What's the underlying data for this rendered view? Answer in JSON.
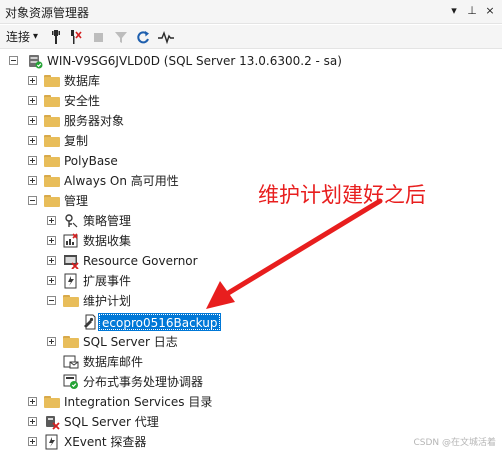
{
  "panel": {
    "title": "对象资源管理器",
    "pin_glyph": "▾",
    "autohide_glyph": "⊥",
    "close_glyph": "×"
  },
  "toolbar": {
    "connect_label": "连接",
    "connect_dropdown_glyph": "▾"
  },
  "tree": {
    "server": "WIN-V9SG6JVLD0D (SQL Server 13.0.6300.2 - sa)",
    "top_nodes": [
      "数据库",
      "安全性",
      "服务器对象",
      "复制",
      "PolyBase",
      "Always On 高可用性",
      "管理"
    ],
    "management": {
      "children": [
        "策略管理",
        "数据收集",
        "Resource Governor",
        "扩展事件",
        "维护计划"
      ],
      "maintenance_plan_item": "ecopro0516Backup",
      "after_children": [
        "SQL Server 日志",
        "数据库邮件",
        "分布式事务处理协调器"
      ]
    },
    "bottom_nodes": [
      "Integration Services 目录",
      "SQL Server 代理",
      "XEvent 探查器"
    ]
  },
  "annotation": {
    "text": "维护计划建好之后",
    "color": "#e81e1e"
  },
  "watermark": "CSDN @在文城活着",
  "colors": {
    "selection": "#0078d7",
    "folder": "#e8bd5a"
  }
}
